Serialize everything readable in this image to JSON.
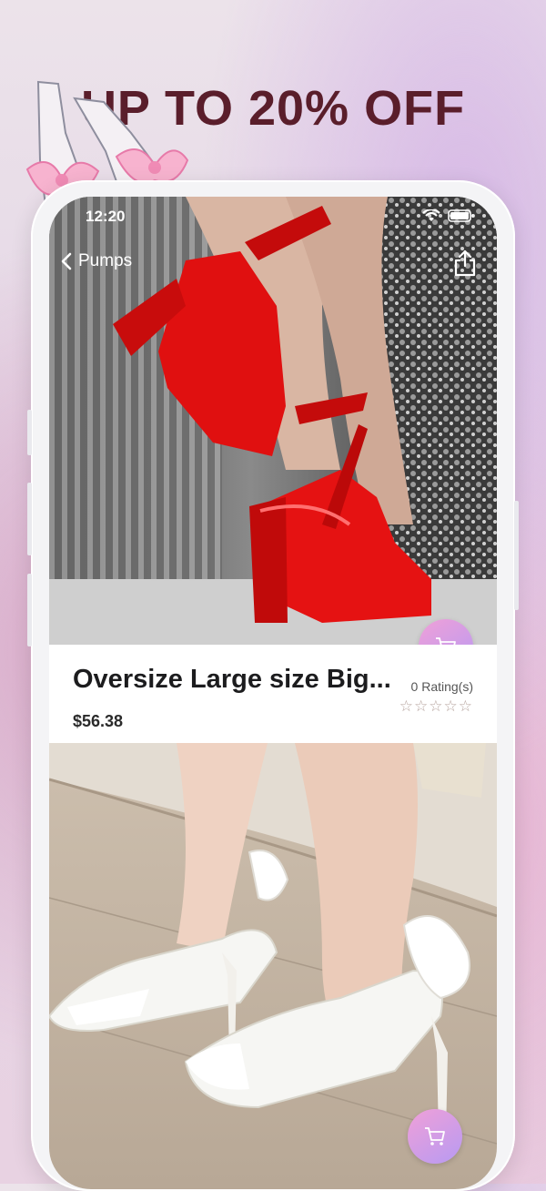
{
  "promo": {
    "headline": "UP TO 20% OFF"
  },
  "status_bar": {
    "time": "12:20"
  },
  "nav": {
    "back_label": "Pumps",
    "share_icon": "share-icon"
  },
  "products": [
    {
      "title": "Oversize Large size Big...",
      "price": "$56.38",
      "rating_count": "0 Rating(s)",
      "stars": "☆☆☆☆☆",
      "image": "red-platform-pumps-photo"
    },
    {
      "image": "white-lace-slingback-heels-photo"
    }
  ],
  "colors": {
    "headline": "#5a1e2b",
    "cart_gradient_start": "#f0a0d8",
    "cart_gradient_end": "#b79af2"
  }
}
